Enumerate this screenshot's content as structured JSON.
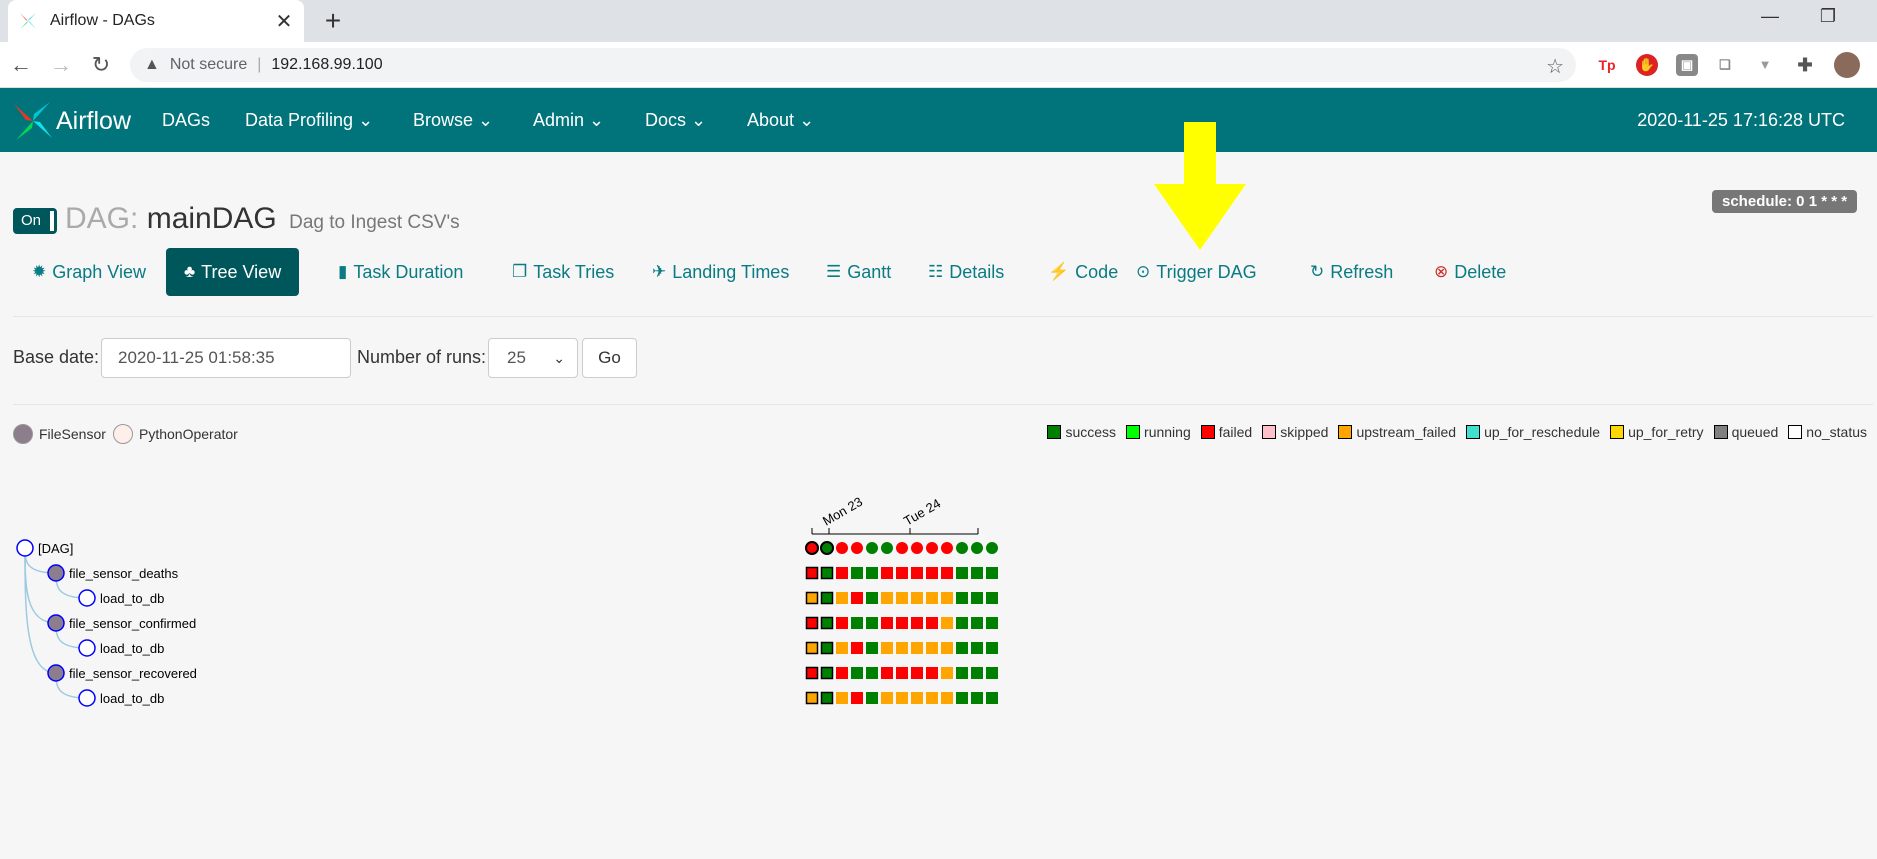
{
  "browser": {
    "tab_title": "Airflow - DAGs",
    "tab_close": "✕",
    "new_tab": "+",
    "not_secure": "Not secure",
    "url": "192.168.99.100"
  },
  "navbar": {
    "brand": "Airflow",
    "items": [
      "DAGs",
      "Data Profiling",
      "Browse",
      "Admin",
      "Docs",
      "About"
    ],
    "clock": "2020-11-25 17:16:28 UTC"
  },
  "header": {
    "toggle": "On",
    "dag_prefix": "DAG:",
    "dag_id": "mainDAG",
    "description": "Dag to Ingest CSV's",
    "schedule": "schedule: 0 1 * * *"
  },
  "view_tabs": [
    {
      "label": "Graph View",
      "icon": "✹"
    },
    {
      "label": "Tree View",
      "icon": "♣"
    },
    {
      "label": "Task Duration",
      "icon": "▮"
    },
    {
      "label": "Task Tries",
      "icon": "❐"
    },
    {
      "label": "Landing Times",
      "icon": "✈"
    },
    {
      "label": "Gantt",
      "icon": "☰"
    },
    {
      "label": "Details",
      "icon": "☷"
    },
    {
      "label": "Code",
      "icon": "⚡"
    },
    {
      "label": "Trigger DAG",
      "icon": "⊙"
    },
    {
      "label": "Refresh",
      "icon": "↻"
    },
    {
      "label": "Delete",
      "icon": "⊗"
    }
  ],
  "form": {
    "base_date_label": "Base date:",
    "base_date_value": "2020-11-25 01:58:35",
    "num_runs_label": "Number of runs:",
    "num_runs_value": "25",
    "go_label": "Go"
  },
  "operators": [
    {
      "name": "FileSensor",
      "color": "#8c7e8c"
    },
    {
      "name": "PythonOperator",
      "color": "#ffefeb"
    }
  ],
  "state_legend": [
    {
      "label": "success",
      "color": "#008000"
    },
    {
      "label": "running",
      "color": "#00ff00"
    },
    {
      "label": "failed",
      "color": "#ff0000"
    },
    {
      "label": "skipped",
      "color": "#ffc0cb"
    },
    {
      "label": "upstream_failed",
      "color": "#ffa500"
    },
    {
      "label": "up_for_reschedule",
      "color": "#40e0d0"
    },
    {
      "label": "up_for_retry",
      "color": "#ffd700"
    },
    {
      "label": "queued",
      "color": "#808080"
    },
    {
      "label": "no_status",
      "color": "#ffffff"
    }
  ],
  "tree": {
    "date_labels": [
      "Mon 23",
      "Tue 24"
    ],
    "nodes": [
      {
        "label": "[DAG]",
        "depth": 0,
        "operator": "DAG"
      },
      {
        "label": "file_sensor_deaths",
        "depth": 1,
        "operator": "FileSensor"
      },
      {
        "label": "load_to_db",
        "depth": 2,
        "operator": "PythonOperator"
      },
      {
        "label": "file_sensor_confirmed",
        "depth": 1,
        "operator": "FileSensor"
      },
      {
        "label": "load_to_db",
        "depth": 2,
        "operator": "PythonOperator"
      },
      {
        "label": "file_sensor_recovered",
        "depth": 1,
        "operator": "FileSensor"
      },
      {
        "label": "load_to_db",
        "depth": 2,
        "operator": "PythonOperator"
      }
    ],
    "dag_runs": [
      "failed",
      "success",
      "failed",
      "failed",
      "success",
      "success",
      "failed",
      "failed",
      "failed",
      "failed",
      "success",
      "success",
      "success"
    ],
    "task_instances": [
      [
        "failed",
        "success",
        "failed",
        "success",
        "success",
        "failed",
        "failed",
        "failed",
        "failed",
        "failed",
        "success",
        "success",
        "success"
      ],
      [
        "upstream_failed",
        "success",
        "upstream_failed",
        "failed",
        "success",
        "upstream_failed",
        "upstream_failed",
        "upstream_failed",
        "upstream_failed",
        "upstream_failed",
        "success",
        "success",
        "success"
      ],
      [
        "failed",
        "success",
        "failed",
        "success",
        "success",
        "failed",
        "failed",
        "failed",
        "failed",
        "upstream_failed",
        "success",
        "success",
        "success"
      ],
      [
        "upstream_failed",
        "success",
        "upstream_failed",
        "failed",
        "success",
        "upstream_failed",
        "upstream_failed",
        "upstream_failed",
        "upstream_failed",
        "upstream_failed",
        "success",
        "success",
        "success"
      ],
      [
        "failed",
        "success",
        "failed",
        "success",
        "success",
        "failed",
        "failed",
        "failed",
        "failed",
        "upstream_failed",
        "success",
        "success",
        "success"
      ],
      [
        "upstream_failed",
        "success",
        "upstream_failed",
        "failed",
        "success",
        "upstream_failed",
        "upstream_failed",
        "upstream_failed",
        "upstream_failed",
        "upstream_failed",
        "success",
        "success",
        "success"
      ]
    ],
    "highlight_runs": [
      0,
      1
    ]
  }
}
